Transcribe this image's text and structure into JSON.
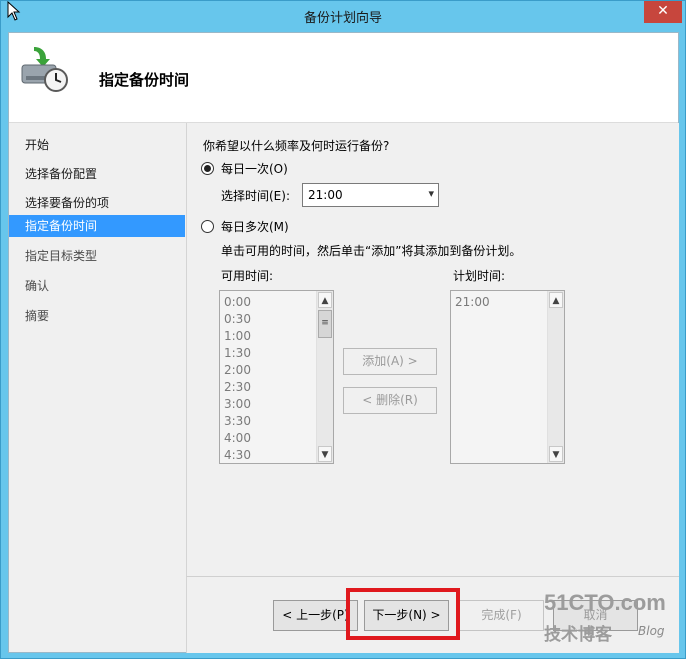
{
  "window": {
    "title": "备份计划向导",
    "close_label": "✕"
  },
  "header": {
    "title": "指定备份时间"
  },
  "sidebar": {
    "steps": [
      {
        "label": "开始",
        "state": "done"
      },
      {
        "label": "选择备份配置",
        "state": "done"
      },
      {
        "label": "选择要备份的项",
        "state": "done"
      },
      {
        "label": "指定备份时间",
        "state": "active"
      },
      {
        "label": "指定目标类型",
        "state": "future"
      },
      {
        "label": "确认",
        "state": "future"
      },
      {
        "label": "摘要",
        "state": "future"
      }
    ]
  },
  "main": {
    "question": "你希望以什么频率及何时运行备份?",
    "once_daily": {
      "label": "每日一次(O)",
      "checked": true
    },
    "select_time": {
      "label": "选择时间(E):",
      "value": "21:00"
    },
    "multi_daily": {
      "label": "每日多次(M)",
      "checked": false
    },
    "description": "单击可用的时间，然后单击“添加”将其添加到备份计划。",
    "available": {
      "label": "可用时间:",
      "items": [
        "0:00",
        "0:30",
        "1:00",
        "1:30",
        "2:00",
        "2:30",
        "3:00",
        "3:30",
        "4:00",
        "4:30"
      ]
    },
    "scheduled": {
      "label": "计划时间:",
      "items": [
        "21:00"
      ]
    },
    "add_button": "添加(A) >",
    "remove_button": "< 删除(R)"
  },
  "footer": {
    "prev_button": "< 上一步(P)",
    "next_button": "下一步(N) >",
    "finish_button": "完成(F)",
    "cancel_button": "取消"
  },
  "watermark": {
    "top": "51CTO.com",
    "bottom": "技术博客",
    "blog": "Blog"
  },
  "colors": {
    "titlebar": "#67c6ec",
    "active_step": "#3399ff",
    "highlight": "#e0191e",
    "close": "#c7463d"
  }
}
